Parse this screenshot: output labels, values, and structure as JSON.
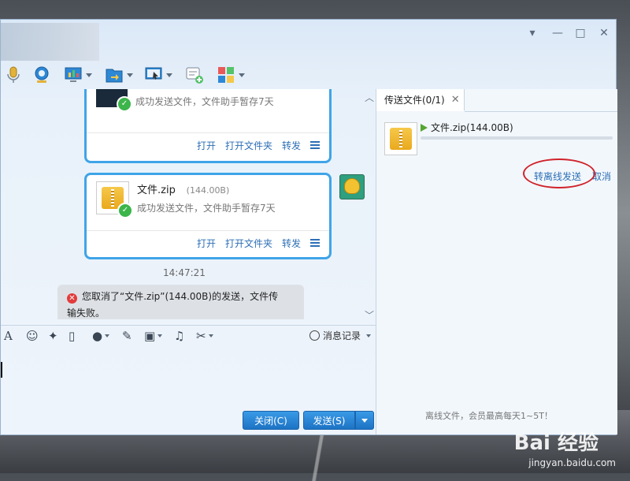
{
  "colors": {
    "accent": "#3fa4e8",
    "link": "#2d6fb5",
    "primary_button": "#1d73c5",
    "error": "#e23b3b",
    "success": "#3cb54a",
    "highlight_ring": "#d0232b"
  },
  "window_controls": {
    "dropdown": "▾",
    "minimize": "—",
    "maximize": "□",
    "close": "✕"
  },
  "toolbar": {
    "icons": [
      "microphone-icon",
      "webcam-icon",
      "screen-share-icon",
      "send-file-icon",
      "remote-desktop-icon",
      "add-app-icon",
      "apps-grid-icon"
    ]
  },
  "chat": {
    "messages": [
      {
        "file_name": "",
        "file_size": "",
        "status": "成功发送文件，文件助手暂存7天",
        "actions": {
          "open": "打开",
          "open_folder": "打开文件夹",
          "forward": "转发"
        }
      },
      {
        "file_name": "文件.zip",
        "file_size": "(144.00B)",
        "status": "成功发送文件，文件助手暂存7天",
        "actions": {
          "open": "打开",
          "open_folder": "打开文件夹",
          "forward": "转发"
        }
      }
    ],
    "timestamp": "14:47:21",
    "notice": {
      "line1": "您取消了“文件.zip”(144.00B)的发送，文件传",
      "line2": "输失败。"
    }
  },
  "input_toolbar": {
    "history_label": "消息记录",
    "icons": [
      "font-icon",
      "emoji-icon",
      "magic-icon",
      "vibrate-icon",
      "voice-icon",
      "edit-icon",
      "image-icon",
      "music-icon",
      "scissors-icon"
    ]
  },
  "buttons": {
    "close": "关闭(C)",
    "send": "发送(S)"
  },
  "transfer_panel": {
    "tab_label": "传送文件(0/1)",
    "file_name": "文件.zip(144.00B)",
    "offline_send": "转离线发送",
    "cancel": "取消",
    "footer": "离线文件，会员最高每天1~5T！"
  },
  "watermark": {
    "brand": "Bai 经验",
    "url": "jingyan.baidu.com"
  }
}
